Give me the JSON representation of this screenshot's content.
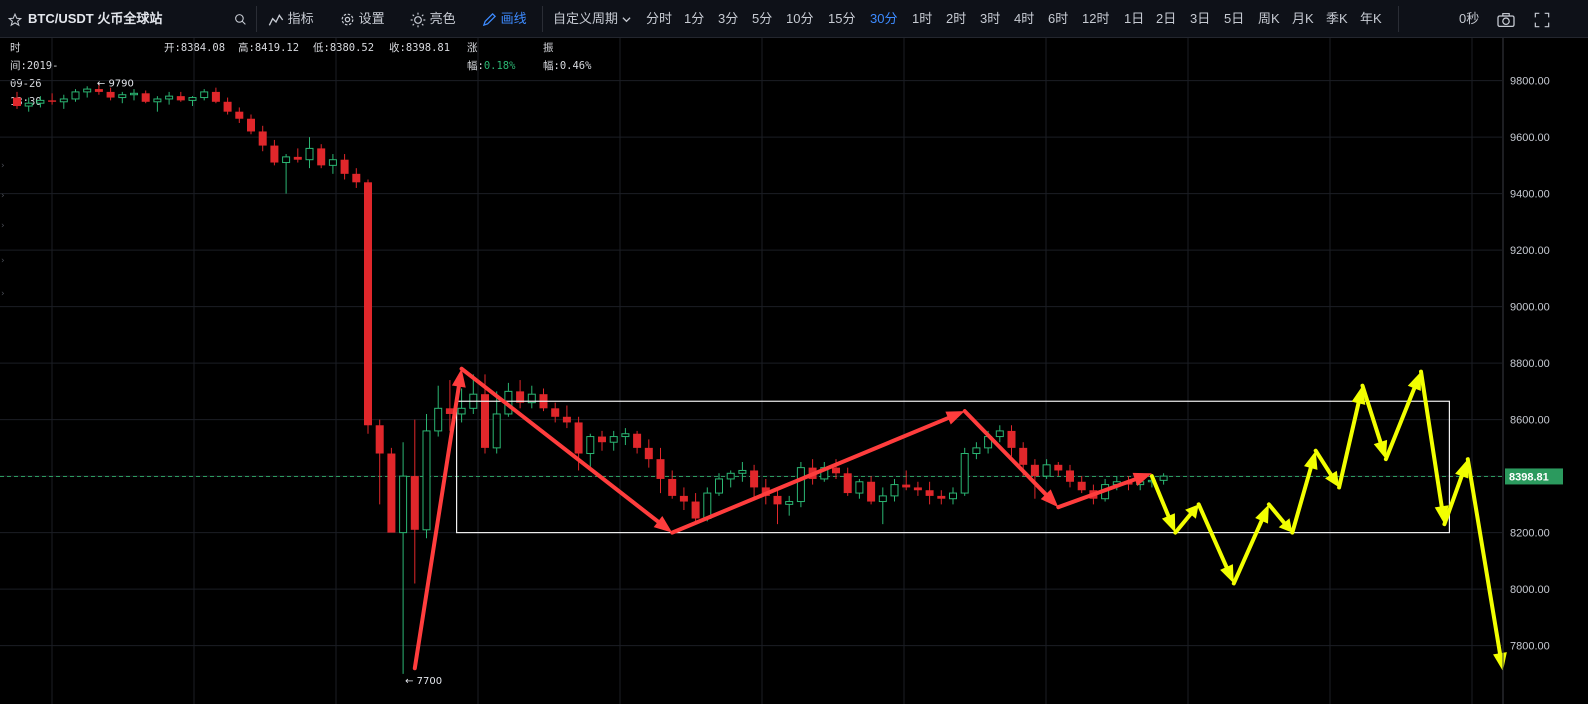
{
  "toolbar": {
    "symbol": "BTC/USDT 火币全球站",
    "indicator_label": "指标",
    "settings_label": "设置",
    "theme_label": "亮色",
    "draw_label": "画线",
    "custom_period_label": "自定义周期",
    "periods": [
      "分时",
      "1分",
      "3分",
      "5分",
      "10分",
      "15分",
      "30分",
      "1时",
      "2时",
      "3时",
      "4时",
      "6时",
      "12时",
      "1日",
      "2日",
      "3日",
      "5日",
      "周K",
      "月K",
      "季K",
      "年K"
    ],
    "active_period": "30分",
    "countdown": "0秒"
  },
  "info": {
    "time_label": "时间:",
    "time": "2019-09-26 13:30",
    "open_label": "开:",
    "open": "8384.08",
    "high_label": "高:",
    "high": "8419.12",
    "low_label": "低:",
    "low": "8380.52",
    "close_label": "收:",
    "close": "8398.81",
    "change_label": "涨幅:",
    "change": "0.18%",
    "amplitude_label": "振幅:",
    "amplitude": "0.46%"
  },
  "colors": {
    "up": "#2bb673",
    "down": "#e0272b",
    "accent": "#3d8bff",
    "annot_red": "#ff3d3d",
    "annot_yellow": "#f2ff00",
    "grid": "#1b1e24",
    "price_tag": "#2b9a5e"
  },
  "chart_data": {
    "type": "candlestick",
    "title": "",
    "y_ticks": [
      "9800.00",
      "9600.00",
      "9400.00",
      "9200.00",
      "9000.00",
      "8800.00",
      "8600.00",
      "8400.00",
      "8200.00",
      "8000.00",
      "7800.00"
    ],
    "ylim": [
      7650,
      9880
    ],
    "current_price": 8398.81,
    "current_price_label": "8398.81",
    "high_marker": {
      "index": 7,
      "value": 9790,
      "label": "← 9790"
    },
    "low_marker": {
      "index": 33,
      "value": 7700,
      "label": "← 7700"
    },
    "grid": true,
    "candles": [
      [
        9740,
        9760,
        9700,
        9710
      ],
      [
        9710,
        9740,
        9690,
        9720
      ],
      [
        9720,
        9745,
        9705,
        9730
      ],
      [
        9730,
        9755,
        9715,
        9725
      ],
      [
        9725,
        9750,
        9700,
        9735
      ],
      [
        9735,
        9770,
        9725,
        9760
      ],
      [
        9760,
        9780,
        9740,
        9770
      ],
      [
        9770,
        9790,
        9750,
        9760
      ],
      [
        9760,
        9775,
        9730,
        9740
      ],
      [
        9740,
        9760,
        9720,
        9750
      ],
      [
        9750,
        9770,
        9730,
        9755
      ],
      [
        9755,
        9765,
        9720,
        9725
      ],
      [
        9725,
        9745,
        9690,
        9735
      ],
      [
        9735,
        9760,
        9715,
        9745
      ],
      [
        9745,
        9760,
        9725,
        9730
      ],
      [
        9730,
        9745,
        9710,
        9740
      ],
      [
        9740,
        9770,
        9730,
        9760
      ],
      [
        9760,
        9775,
        9720,
        9725
      ],
      [
        9725,
        9740,
        9680,
        9690
      ],
      [
        9690,
        9705,
        9650,
        9665
      ],
      [
        9665,
        9680,
        9610,
        9620
      ],
      [
        9620,
        9640,
        9550,
        9570
      ],
      [
        9570,
        9590,
        9500,
        9510
      ],
      [
        9510,
        9540,
        9400,
        9530
      ],
      [
        9530,
        9560,
        9510,
        9520
      ],
      [
        9520,
        9600,
        9490,
        9560
      ],
      [
        9560,
        9575,
        9490,
        9500
      ],
      [
        9500,
        9540,
        9470,
        9520
      ],
      [
        9520,
        9540,
        9450,
        9470
      ],
      [
        9470,
        9490,
        9420,
        9440
      ],
      [
        9440,
        9450,
        8550,
        8580
      ],
      [
        8580,
        8600,
        8300,
        8480
      ],
      [
        8480,
        8500,
        8250,
        8200
      ],
      [
        8200,
        8520,
        7700,
        8400
      ],
      [
        8400,
        8600,
        8020,
        8210
      ],
      [
        8210,
        8620,
        8180,
        8560
      ],
      [
        8560,
        8720,
        8540,
        8640
      ],
      [
        8640,
        8740,
        8560,
        8620
      ],
      [
        8620,
        8710,
        8590,
        8640
      ],
      [
        8640,
        8760,
        8620,
        8690
      ],
      [
        8690,
        8760,
        8480,
        8500
      ],
      [
        8500,
        8700,
        8480,
        8620
      ],
      [
        8620,
        8730,
        8610,
        8700
      ],
      [
        8700,
        8740,
        8640,
        8660
      ],
      [
        8660,
        8720,
        8640,
        8690
      ],
      [
        8690,
        8710,
        8630,
        8640
      ],
      [
        8640,
        8660,
        8590,
        8610
      ],
      [
        8610,
        8650,
        8570,
        8590
      ],
      [
        8590,
        8610,
        8420,
        8480
      ],
      [
        8480,
        8550,
        8430,
        8540
      ],
      [
        8540,
        8560,
        8490,
        8520
      ],
      [
        8520,
        8560,
        8490,
        8540
      ],
      [
        8540,
        8570,
        8510,
        8550
      ],
      [
        8550,
        8560,
        8480,
        8500
      ],
      [
        8500,
        8530,
        8430,
        8460
      ],
      [
        8460,
        8500,
        8340,
        8390
      ],
      [
        8390,
        8420,
        8320,
        8330
      ],
      [
        8330,
        8360,
        8280,
        8310
      ],
      [
        8310,
        8340,
        8230,
        8250
      ],
      [
        8250,
        8360,
        8240,
        8340
      ],
      [
        8340,
        8410,
        8330,
        8390
      ],
      [
        8390,
        8420,
        8360,
        8410
      ],
      [
        8410,
        8450,
        8380,
        8420
      ],
      [
        8420,
        8440,
        8320,
        8360
      ],
      [
        8360,
        8390,
        8300,
        8330
      ],
      [
        8330,
        8360,
        8230,
        8300
      ],
      [
        8300,
        8330,
        8260,
        8310
      ],
      [
        8310,
        8450,
        8290,
        8430
      ],
      [
        8430,
        8460,
        8370,
        8390
      ],
      [
        8390,
        8450,
        8380,
        8430
      ],
      [
        8430,
        8460,
        8390,
        8410
      ],
      [
        8410,
        8430,
        8330,
        8340
      ],
      [
        8340,
        8390,
        8320,
        8380
      ],
      [
        8380,
        8400,
        8300,
        8310
      ],
      [
        8310,
        8360,
        8230,
        8330
      ],
      [
        8330,
        8390,
        8310,
        8370
      ],
      [
        8370,
        8420,
        8350,
        8360
      ],
      [
        8360,
        8380,
        8330,
        8350
      ],
      [
        8350,
        8380,
        8300,
        8330
      ],
      [
        8330,
        8350,
        8300,
        8320
      ],
      [
        8320,
        8360,
        8300,
        8340
      ],
      [
        8340,
        8500,
        8330,
        8480
      ],
      [
        8480,
        8520,
        8460,
        8500
      ],
      [
        8500,
        8560,
        8480,
        8540
      ],
      [
        8540,
        8580,
        8520,
        8560
      ],
      [
        8560,
        8580,
        8470,
        8500
      ],
      [
        8500,
        8520,
        8400,
        8440
      ],
      [
        8440,
        8460,
        8320,
        8400
      ],
      [
        8400,
        8460,
        8390,
        8440
      ],
      [
        8440,
        8450,
        8400,
        8420
      ],
      [
        8420,
        8440,
        8360,
        8380
      ],
      [
        8380,
        8400,
        8340,
        8350
      ],
      [
        8350,
        8370,
        8300,
        8320
      ],
      [
        8320,
        8390,
        8310,
        8370
      ],
      [
        8370,
        8400,
        8350,
        8380
      ],
      [
        8380,
        8400,
        8350,
        8370
      ],
      [
        8370,
        8390,
        8350,
        8380
      ],
      [
        8380,
        8400,
        8360,
        8385
      ],
      [
        8385,
        8410,
        8370,
        8400
      ]
    ],
    "annotations": {
      "box": {
        "x_from": 38,
        "x_to": 122,
        "y_top": 8665,
        "y_bottom": 8200
      },
      "red_path": [
        [
          34,
          7720
        ],
        [
          38,
          8780
        ],
        [
          56,
          8200
        ],
        [
          81,
          8630
        ],
        [
          89,
          8290
        ],
        [
          97,
          8410
        ]
      ],
      "yellow_path": [
        [
          97,
          8400
        ],
        [
          99,
          8200
        ],
        [
          101,
          8300
        ],
        [
          104,
          8020
        ],
        [
          107,
          8300
        ],
        [
          109,
          8200
        ],
        [
          111,
          8490
        ],
        [
          113,
          8360
        ],
        [
          115,
          8720
        ],
        [
          117,
          8460
        ],
        [
          120,
          8770
        ],
        [
          122,
          8230
        ],
        [
          124,
          8460
        ],
        [
          127,
          7710
        ]
      ]
    }
  }
}
